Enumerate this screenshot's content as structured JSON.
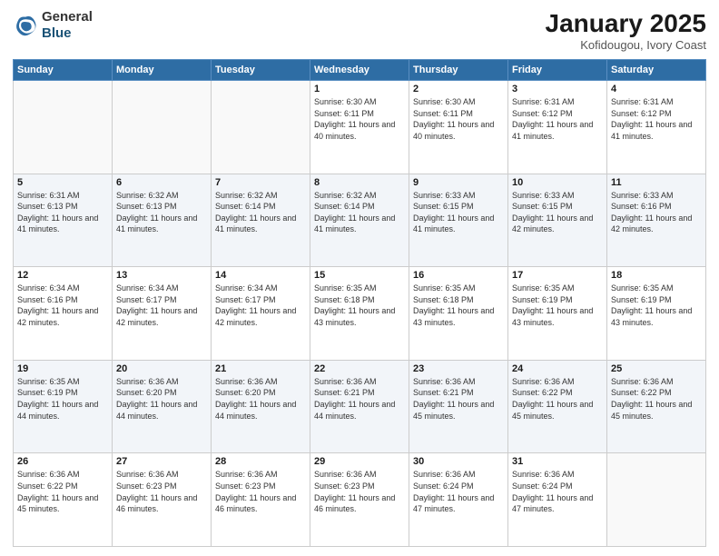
{
  "header": {
    "logo_general": "General",
    "logo_blue": "Blue",
    "month_title": "January 2025",
    "subtitle": "Kofidougou, Ivory Coast"
  },
  "weekdays": [
    "Sunday",
    "Monday",
    "Tuesday",
    "Wednesday",
    "Thursday",
    "Friday",
    "Saturday"
  ],
  "weeks": [
    [
      {
        "day": "",
        "info": ""
      },
      {
        "day": "",
        "info": ""
      },
      {
        "day": "",
        "info": ""
      },
      {
        "day": "1",
        "info": "Sunrise: 6:30 AM\nSunset: 6:11 PM\nDaylight: 11 hours and 40 minutes."
      },
      {
        "day": "2",
        "info": "Sunrise: 6:30 AM\nSunset: 6:11 PM\nDaylight: 11 hours and 40 minutes."
      },
      {
        "day": "3",
        "info": "Sunrise: 6:31 AM\nSunset: 6:12 PM\nDaylight: 11 hours and 41 minutes."
      },
      {
        "day": "4",
        "info": "Sunrise: 6:31 AM\nSunset: 6:12 PM\nDaylight: 11 hours and 41 minutes."
      }
    ],
    [
      {
        "day": "5",
        "info": "Sunrise: 6:31 AM\nSunset: 6:13 PM\nDaylight: 11 hours and 41 minutes."
      },
      {
        "day": "6",
        "info": "Sunrise: 6:32 AM\nSunset: 6:13 PM\nDaylight: 11 hours and 41 minutes."
      },
      {
        "day": "7",
        "info": "Sunrise: 6:32 AM\nSunset: 6:14 PM\nDaylight: 11 hours and 41 minutes."
      },
      {
        "day": "8",
        "info": "Sunrise: 6:32 AM\nSunset: 6:14 PM\nDaylight: 11 hours and 41 minutes."
      },
      {
        "day": "9",
        "info": "Sunrise: 6:33 AM\nSunset: 6:15 PM\nDaylight: 11 hours and 41 minutes."
      },
      {
        "day": "10",
        "info": "Sunrise: 6:33 AM\nSunset: 6:15 PM\nDaylight: 11 hours and 42 minutes."
      },
      {
        "day": "11",
        "info": "Sunrise: 6:33 AM\nSunset: 6:16 PM\nDaylight: 11 hours and 42 minutes."
      }
    ],
    [
      {
        "day": "12",
        "info": "Sunrise: 6:34 AM\nSunset: 6:16 PM\nDaylight: 11 hours and 42 minutes."
      },
      {
        "day": "13",
        "info": "Sunrise: 6:34 AM\nSunset: 6:17 PM\nDaylight: 11 hours and 42 minutes."
      },
      {
        "day": "14",
        "info": "Sunrise: 6:34 AM\nSunset: 6:17 PM\nDaylight: 11 hours and 42 minutes."
      },
      {
        "day": "15",
        "info": "Sunrise: 6:35 AM\nSunset: 6:18 PM\nDaylight: 11 hours and 43 minutes."
      },
      {
        "day": "16",
        "info": "Sunrise: 6:35 AM\nSunset: 6:18 PM\nDaylight: 11 hours and 43 minutes."
      },
      {
        "day": "17",
        "info": "Sunrise: 6:35 AM\nSunset: 6:19 PM\nDaylight: 11 hours and 43 minutes."
      },
      {
        "day": "18",
        "info": "Sunrise: 6:35 AM\nSunset: 6:19 PM\nDaylight: 11 hours and 43 minutes."
      }
    ],
    [
      {
        "day": "19",
        "info": "Sunrise: 6:35 AM\nSunset: 6:19 PM\nDaylight: 11 hours and 44 minutes."
      },
      {
        "day": "20",
        "info": "Sunrise: 6:36 AM\nSunset: 6:20 PM\nDaylight: 11 hours and 44 minutes."
      },
      {
        "day": "21",
        "info": "Sunrise: 6:36 AM\nSunset: 6:20 PM\nDaylight: 11 hours and 44 minutes."
      },
      {
        "day": "22",
        "info": "Sunrise: 6:36 AM\nSunset: 6:21 PM\nDaylight: 11 hours and 44 minutes."
      },
      {
        "day": "23",
        "info": "Sunrise: 6:36 AM\nSunset: 6:21 PM\nDaylight: 11 hours and 45 minutes."
      },
      {
        "day": "24",
        "info": "Sunrise: 6:36 AM\nSunset: 6:22 PM\nDaylight: 11 hours and 45 minutes."
      },
      {
        "day": "25",
        "info": "Sunrise: 6:36 AM\nSunset: 6:22 PM\nDaylight: 11 hours and 45 minutes."
      }
    ],
    [
      {
        "day": "26",
        "info": "Sunrise: 6:36 AM\nSunset: 6:22 PM\nDaylight: 11 hours and 45 minutes."
      },
      {
        "day": "27",
        "info": "Sunrise: 6:36 AM\nSunset: 6:23 PM\nDaylight: 11 hours and 46 minutes."
      },
      {
        "day": "28",
        "info": "Sunrise: 6:36 AM\nSunset: 6:23 PM\nDaylight: 11 hours and 46 minutes."
      },
      {
        "day": "29",
        "info": "Sunrise: 6:36 AM\nSunset: 6:23 PM\nDaylight: 11 hours and 46 minutes."
      },
      {
        "day": "30",
        "info": "Sunrise: 6:36 AM\nSunset: 6:24 PM\nDaylight: 11 hours and 47 minutes."
      },
      {
        "day": "31",
        "info": "Sunrise: 6:36 AM\nSunset: 6:24 PM\nDaylight: 11 hours and 47 minutes."
      },
      {
        "day": "",
        "info": ""
      }
    ]
  ]
}
